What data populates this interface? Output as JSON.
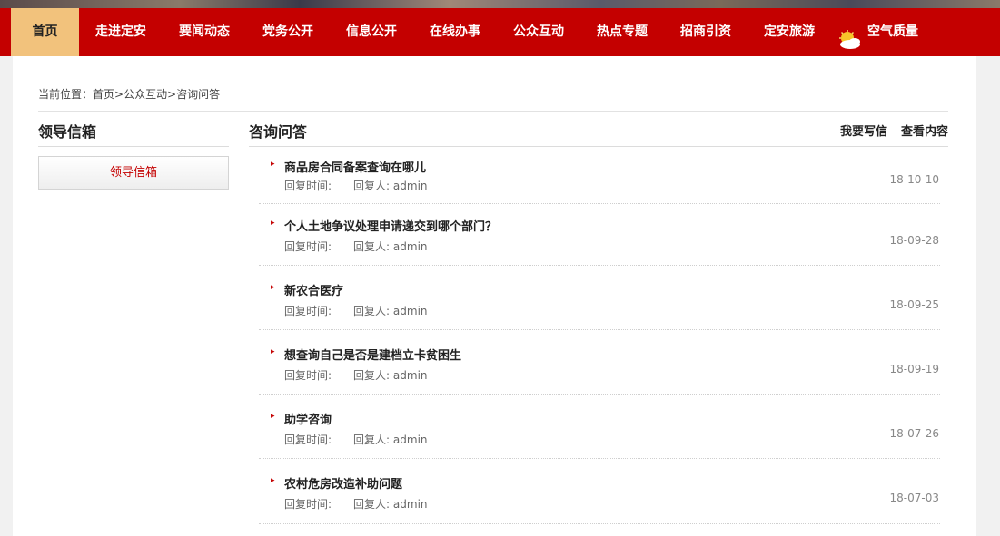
{
  "nav": {
    "items": [
      {
        "label": "首页",
        "active": true
      },
      {
        "label": "走进定安"
      },
      {
        "label": "要闻动态"
      },
      {
        "label": "党务公开"
      },
      {
        "label": "信息公开"
      },
      {
        "label": "在线办事"
      },
      {
        "label": "公众互动"
      },
      {
        "label": "热点专题"
      },
      {
        "label": "招商引资"
      },
      {
        "label": "定安旅游"
      }
    ],
    "weather": {
      "label": "空气质量",
      "icon": "weather-sun-cloud-icon"
    },
    "colors": {
      "bar": "#c40000",
      "active": "#f2c27c"
    }
  },
  "breadcrumb": {
    "prefix": "当前位置：",
    "home": "首页",
    "sep1": ">",
    "section": "公众互动",
    "sep2": ">",
    "current": "咨询问答"
  },
  "sidebar": {
    "title": "领导信箱",
    "button": "领导信箱"
  },
  "main": {
    "title": "咨询问答",
    "write_link": "我要写信",
    "view_link": "查看内容",
    "reply_time_label": "回复时间:",
    "replier_label": "回复人: ",
    "items": [
      {
        "question": "商品房合同备案查询在哪儿",
        "replier": "admin",
        "date": "18-10-10"
      },
      {
        "question": "个人土地争议处理申请递交到哪个部门？",
        "replier": "admin",
        "date": "18-09-28"
      },
      {
        "question": "新农合医疗",
        "replier": "admin",
        "date": "18-09-25"
      },
      {
        "question": "想查询自己是否是建档立卡贫困生",
        "replier": "admin",
        "date": "18-09-19"
      },
      {
        "question": "助学咨询",
        "replier": "admin",
        "date": "18-07-26"
      },
      {
        "question": "农村危房改造补助问题",
        "replier": "admin",
        "date": "18-07-03"
      }
    ]
  }
}
